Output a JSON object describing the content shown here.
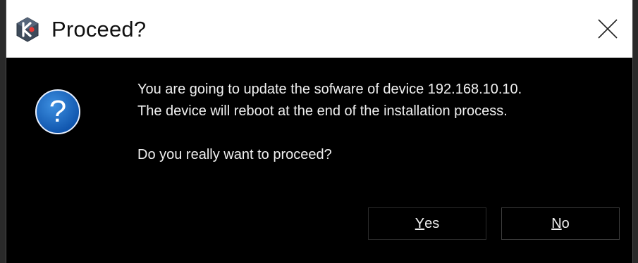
{
  "window": {
    "title": "Proceed?",
    "app_icon": "kilovault-hexagon-icon",
    "close_icon": "close-icon"
  },
  "dialog": {
    "icon": "question-icon",
    "icon_glyph": "?",
    "message_line_1": "You are going to update the sofware of device 192.168.10.10.",
    "message_line_2": "The device will reboot at the end of the installation process.",
    "message_line_3": "Do you really want to proceed?"
  },
  "buttons": {
    "yes": {
      "mnemonic": "Y",
      "rest": "es"
    },
    "no": {
      "mnemonic": "N",
      "rest": "o"
    }
  },
  "colors": {
    "titlebar_bg": "#ffffff",
    "dialog_bg": "#000000",
    "text": "#f0f0f0",
    "question_icon_blue": "#1565c0",
    "app_icon_dark": "#3d4a5a",
    "app_icon_accent": "#e53935"
  }
}
